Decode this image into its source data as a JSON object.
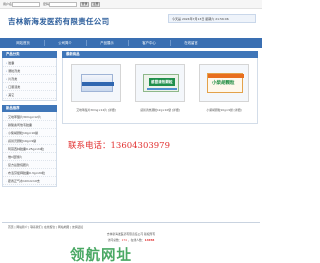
{
  "login": {
    "user_label": "用户名",
    "pass_label": "密码",
    "login_btn": "登录",
    "reg_btn": "注册"
  },
  "header": {
    "title": "吉林新海发医药有限责任公司",
    "date_text": "今天是 2024年7月13日 星期六 21:56:06"
  },
  "nav": [
    "网站首页",
    "公司简介",
    "产品展示",
    "客户中心",
    "在线留言"
  ],
  "sidebar": {
    "heading1": "产品分类",
    "cats": [
      "胶囊",
      "颗粒剂类",
      "片剂类",
      "口服液类",
      "其它"
    ],
    "heading2": "新品推荐",
    "items": [
      "艾地苯醌片30mg×12片",
      "磷酸奥司他韦胶囊",
      "小柴胡颗粒10g×10袋",
      "感冒灵颗粒10g×9袋",
      "阿莫西林胶囊0.25g×24粒",
      "维C银翘片",
      "复方氨酚烷胺片",
      "布洛芬缓释胶囊0.3g×20粒",
      "藿香正气水10ml×10支"
    ]
  },
  "main": {
    "heading": "最新商品",
    "products": [
      {
        "caption": "艾地苯醌片30mg×12片 [详细]"
      },
      {
        "caption": "感冒清热颗粒12g×10袋 [详细]",
        "box_text": "感冒清热颗粒"
      },
      {
        "caption": "小柴胡颗粒10g×9袋 [详细]",
        "box_text": "小柴胡颗粒"
      }
    ]
  },
  "contact": "联系电话：13604303979",
  "footer": {
    "links": "首页 | 网站简介 | 联系我们 | 在线留言 | 网站地图 | 友情链接",
    "company": "吉林新海发医药有限责任公司 版权所有",
    "count_prefix": "访问总数：",
    "count1": "174",
    "count_mid": " ，在线人数：",
    "count2": "14658"
  },
  "watermark": "领航网址",
  "colors": {
    "accent": "#3a6fb2",
    "contact": "#e23232",
    "watermark": "#2b9a4a"
  }
}
